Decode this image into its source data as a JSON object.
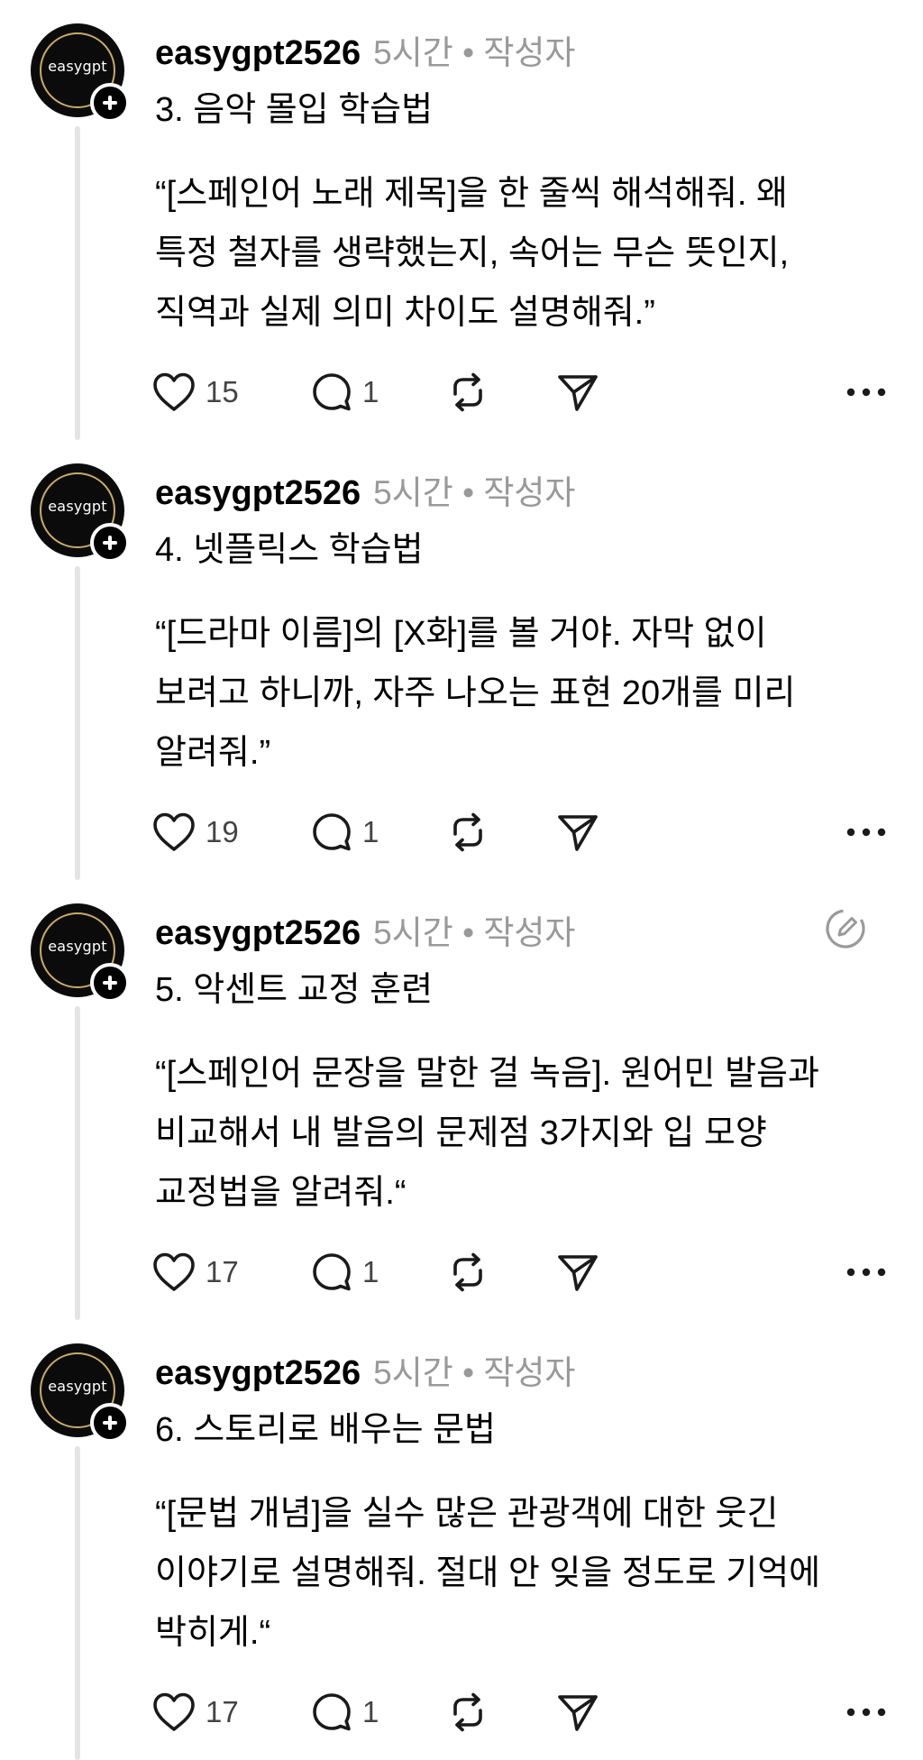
{
  "posts": [
    {
      "username": "easygpt2526",
      "meta": "5시간 • 작성자",
      "avatar_text": "easygpt",
      "title": "3. 음악 몰입 학습법",
      "body_lines": [
        "“[스페인어 노래 제목]을 한 줄씩 해석해줘. 왜",
        "특정 철자를 생략했는지, 속어는 무슨 뜻인지,",
        "직역과 실제 의미 차이도 설명해줘.”"
      ],
      "likes": "15",
      "replies": "1",
      "edited_icon": false
    },
    {
      "username": "easygpt2526",
      "meta": "5시간 • 작성자",
      "avatar_text": "easygpt",
      "title": "4. 넷플릭스 학습법",
      "body_lines": [
        "“[드라마 이름]의 [X화]를 볼 거야. 자막 없이",
        "보려고 하니까, 자주 나오는 표현 20개를 미리",
        "알려줘.”"
      ],
      "likes": "19",
      "replies": "1",
      "edited_icon": false
    },
    {
      "username": "easygpt2526",
      "meta": "5시간 • 작성자",
      "avatar_text": "easygpt",
      "title": "5. 악센트 교정 훈련",
      "body_lines": [
        "“[스페인어 문장을 말한 걸 녹음]. 원어민 발음과",
        "비교해서 내 발음의 문제점 3가지와 입 모양",
        "교정법을 알려줘.“"
      ],
      "likes": "17",
      "replies": "1",
      "edited_icon": true
    },
    {
      "username": "easygpt2526",
      "meta": "5시간 • 작성자",
      "avatar_text": "easygpt",
      "title": "6. 스토리로 배우는 문법",
      "body_lines": [
        "“[문법 개념]을 실수 많은 관광객에 대한 웃긴",
        "이야기로 설명해줘. 절대 안 잊을 정도로 기억에",
        "박히게.“"
      ],
      "likes": "17",
      "replies": "1",
      "edited_icon": false
    }
  ],
  "icons": {
    "like": "heart-icon",
    "reply": "comment-bubble-icon",
    "repost": "repost-icon",
    "share": "send-icon",
    "more": "more-dots-icon",
    "follow": "plus-icon",
    "edited": "edit-pencil-icon"
  },
  "colors": {
    "avatar_bg": "#0b0b0b",
    "avatar_ring": "#c9a968",
    "meta_text": "#999999",
    "thread_line": "#e4e4e4"
  }
}
